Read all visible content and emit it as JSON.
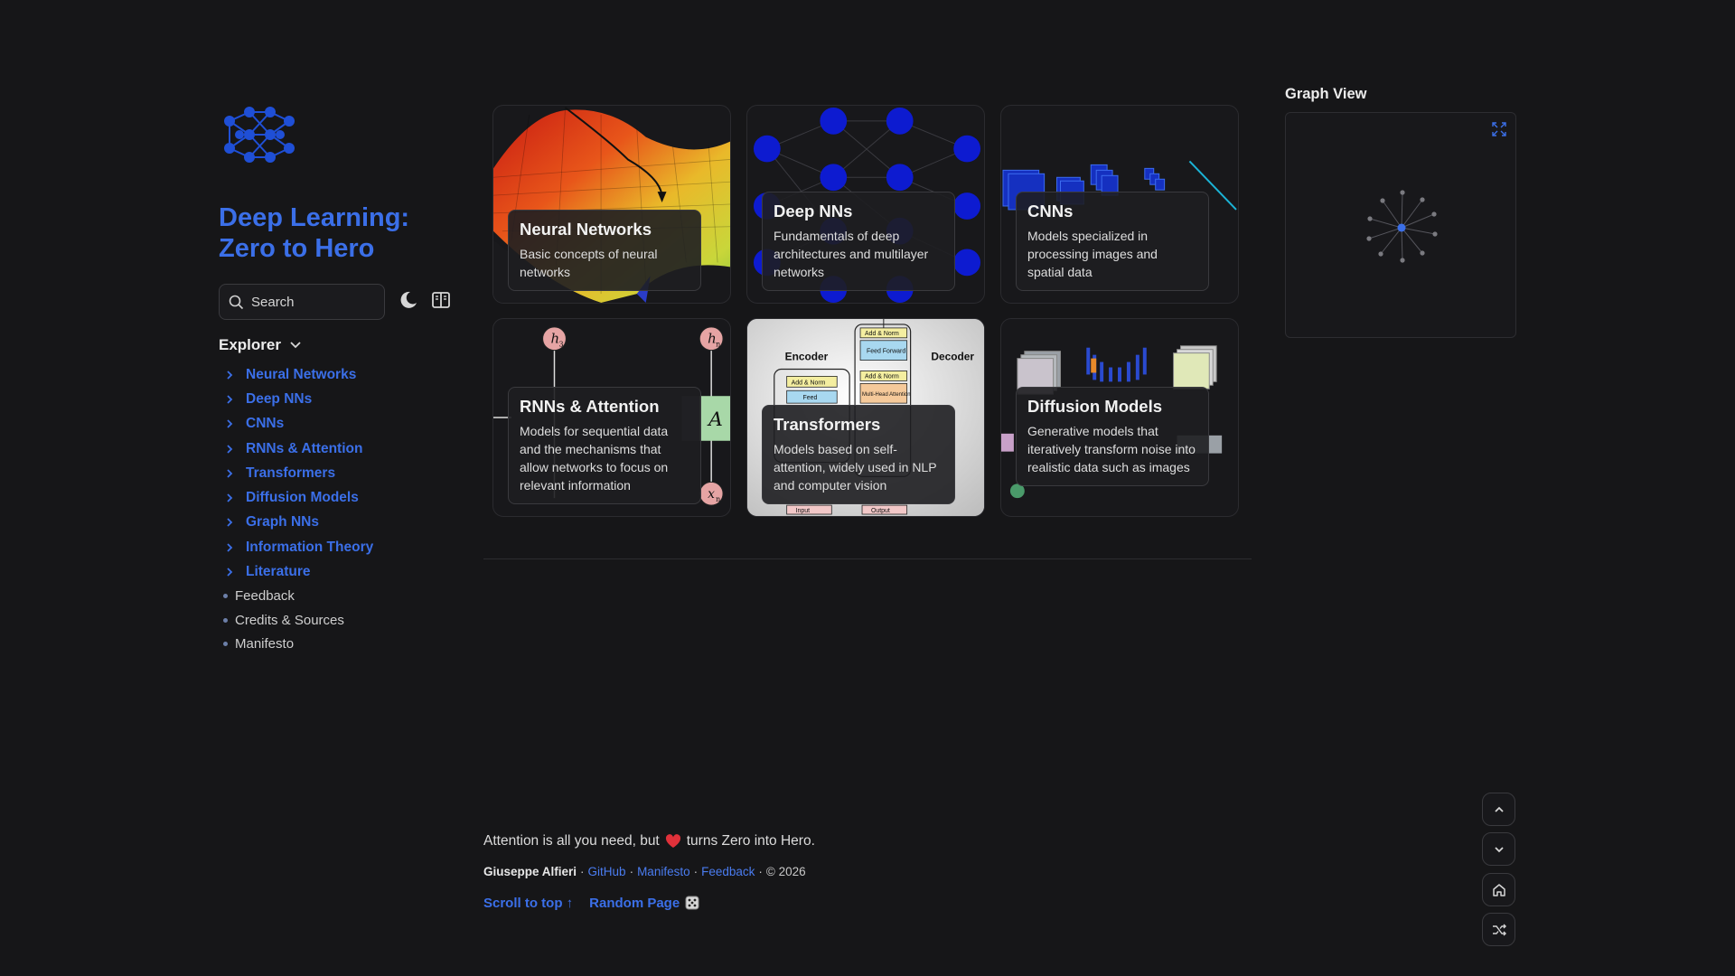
{
  "site": {
    "title": "Deep Learning: Zero to Hero",
    "search_placeholder": "Search",
    "icons": {
      "logo": "neural-net-logo-icon",
      "dark_mode": "moon-icon",
      "reader_mode": "book-icon"
    }
  },
  "explorer": {
    "label": "Explorer",
    "folders": [
      {
        "label": "Neural Networks"
      },
      {
        "label": "Deep NNs"
      },
      {
        "label": "CNNs"
      },
      {
        "label": "RNNs & Attention"
      },
      {
        "label": "Transformers"
      },
      {
        "label": "Diffusion Models"
      },
      {
        "label": "Graph NNs"
      },
      {
        "label": "Information Theory"
      },
      {
        "label": "Literature"
      }
    ],
    "pages": [
      {
        "label": "Feedback"
      },
      {
        "label": "Credits & Sources"
      },
      {
        "label": "Manifesto"
      }
    ]
  },
  "cards": [
    {
      "title": "Neural Networks",
      "desc": "Basic concepts of neural networks"
    },
    {
      "title": "Deep NNs",
      "desc": "Fundamentals of deep architectures and multilayer networks"
    },
    {
      "title": "CNNs",
      "desc": "Models specialized in processing images and spatial data"
    },
    {
      "title": "RNNs & Attention",
      "desc": "Models for sequential data and the mechanisms that allow networks to focus on relevant information"
    },
    {
      "title": "Transformers",
      "desc": "Models based on self-attention, widely used in NLP and computer vision"
    },
    {
      "title": "Diffusion Models",
      "desc": "Generative models that iteratively transform noise into realistic data such as images"
    }
  ],
  "card_art_text": {
    "rnn": {
      "h3": "h",
      "h3_sub": "3",
      "hn": "h",
      "hn_sub": "n",
      "a": "A",
      "xn": "x",
      "xn_sub": "n"
    },
    "transformer": {
      "encoder": "Encoder",
      "decoder": "Decoder",
      "add_norm": "Add & Norm",
      "feed_forward": "Feed Forward",
      "multi_head": "Multi-Head Attention",
      "input": "Input",
      "output": "Output"
    }
  },
  "graph": {
    "title": "Graph View",
    "expand_icon": "expand-icon"
  },
  "footer": {
    "quote_before": "Attention is all you need, but",
    "quote_after": "turns Zero into Hero.",
    "heart_icon": "heart-icon",
    "author": "Giuseppe Alfieri",
    "sep": "·",
    "links": [
      "GitHub",
      "Manifesto",
      "Feedback"
    ],
    "copyright": "© 2026",
    "scroll_top": "Scroll to top ↑",
    "random_page": "Random Page",
    "dice_icon": "dice-icon"
  },
  "floating_buttons": [
    "chevron-up-icon",
    "chevron-down-icon",
    "home-icon",
    "shuffle-icon"
  ],
  "colors": {
    "accent": "#3b6fe8",
    "background": "#161618"
  }
}
